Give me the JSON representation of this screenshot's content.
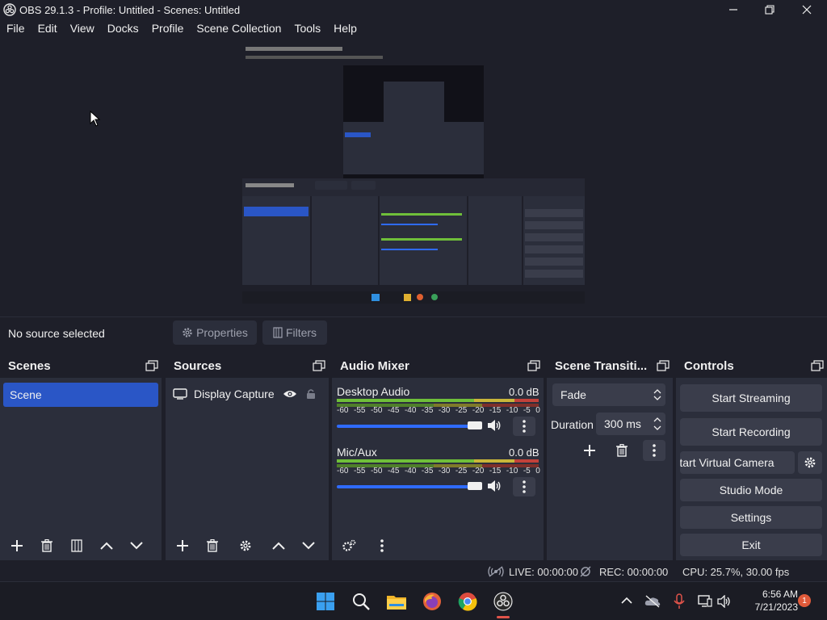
{
  "window": {
    "title": "OBS 29.1.3 - Profile: Untitled - Scenes: Untitled",
    "controls": [
      "minimize",
      "maximize",
      "close"
    ]
  },
  "menu": [
    "File",
    "Edit",
    "View",
    "Docks",
    "Profile",
    "Scene Collection",
    "Tools",
    "Help"
  ],
  "source_toolbar": {
    "status": "No source selected",
    "properties_label": "Properties",
    "filters_label": "Filters"
  },
  "scenes": {
    "title": "Scenes",
    "items": [
      "Scene"
    ],
    "selected": "Scene"
  },
  "sources": {
    "title": "Sources",
    "items": [
      {
        "name": "Display Capture",
        "visible": true,
        "locked": false
      }
    ]
  },
  "audio_mixer": {
    "title": "Audio Mixer",
    "scale": [
      "-60",
      "-55",
      "-50",
      "-45",
      "-40",
      "-35",
      "-30",
      "-25",
      "-20",
      "-15",
      "-10",
      "-5",
      "0"
    ],
    "channels": [
      {
        "name": "Desktop Audio",
        "level": "0.0 dB",
        "volume": 1.0
      },
      {
        "name": "Mic/Aux",
        "level": "0.0 dB",
        "volume": 1.0
      }
    ]
  },
  "transitions": {
    "title": "Scene Transiti...",
    "selected": "Fade",
    "duration_label": "Duration",
    "duration_value": "300 ms"
  },
  "controls": {
    "title": "Controls",
    "start_streaming": "Start Streaming",
    "start_recording": "Start Recording",
    "start_virtual_camera": "Start Virtual Camera",
    "studio_mode": "Studio Mode",
    "settings": "Settings",
    "exit": "Exit"
  },
  "status": {
    "live": "LIVE: 00:00:00",
    "rec": "REC: 00:00:00",
    "cpu": "CPU: 25.7%, 30.00 fps"
  },
  "taskbar": {
    "time": "6:56 AM",
    "date": "7/21/2023",
    "notification_count": "1",
    "pinned": [
      "windows-start",
      "search",
      "file-explorer",
      "firefox",
      "chrome",
      "obs"
    ]
  },
  "colors": {
    "background": "#1e1f29",
    "panel": "#2b2e3b",
    "button": "#3a3d4b",
    "accent": "#2a56c6",
    "slider": "#2f6bff",
    "meter_green": "#6fbf3a",
    "meter_yellow": "#c9b63a",
    "meter_red": "#c2413a"
  }
}
